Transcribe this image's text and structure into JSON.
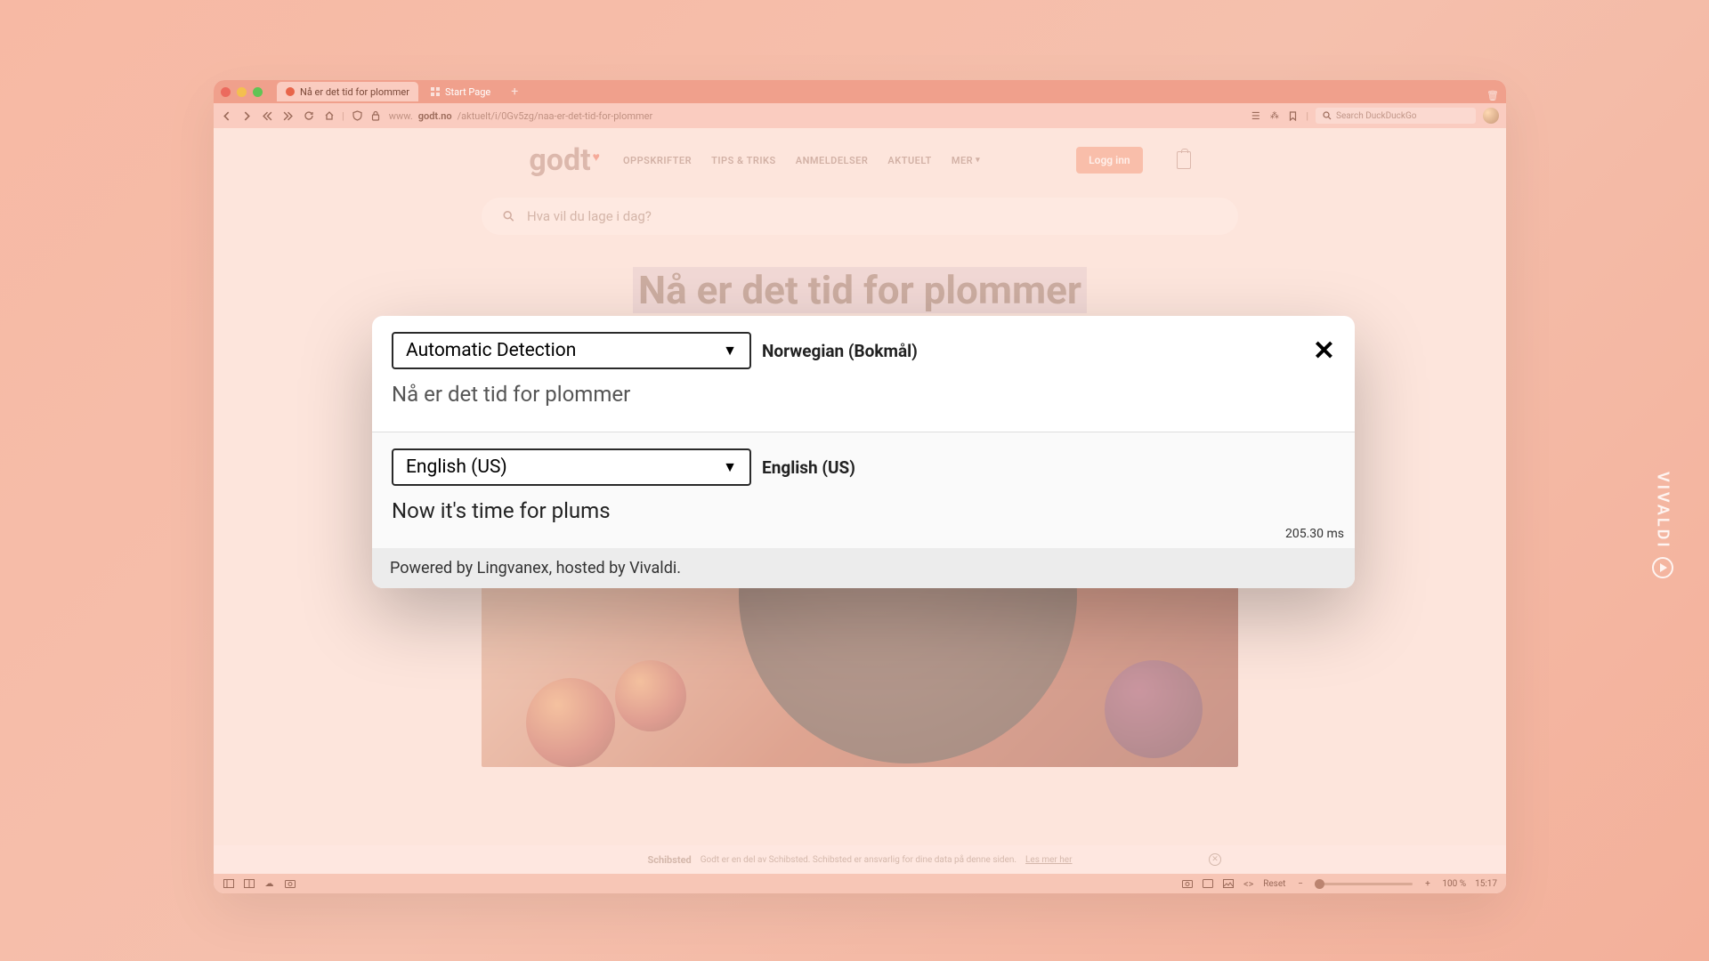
{
  "tabs": {
    "active": {
      "title": "Nå er det tid for plommer"
    },
    "second": {
      "title": "Start Page"
    }
  },
  "address": {
    "proto": "www.",
    "host": "godt.no",
    "path": "/aktuelt/i/0Gv5zg/naa-er-det-tid-for-plommer"
  },
  "search": {
    "placeholder": "Search DuckDuckGo"
  },
  "site": {
    "logo": "godt",
    "nav": {
      "oppskrifter": "OPPSKRIFTER",
      "tips": "TIPS & TRIKS",
      "anmeld": "ANMELDELSER",
      "aktuelt": "AKTUELT",
      "mer": "MER"
    },
    "login": "Logg inn",
    "searchbar_placeholder": "Hva vil du lage i dag?",
    "headline": "Nå er det tid for plommer",
    "schibsted_brand": "Schibsted",
    "schibsted_text": "Godt er en del av Schibsted. Schibsted er ansvarlig for dine data på denne siden.",
    "schibsted_link": "Les mer her"
  },
  "statusbar": {
    "reset": "Reset",
    "zoom": "100 %",
    "clock": "15:17"
  },
  "popup": {
    "source_select": "Automatic Detection",
    "source_detected": "Norwegian (Bokmål)",
    "source_text": "Nå er det tid for plommer",
    "target_select": "English (US)",
    "target_detected": "English (US)",
    "target_text": "Now it's time for plums",
    "timing": "205.30 ms",
    "footer": "Powered by Lingvanex, hosted by Vivaldi."
  },
  "watermark": "VIVALDI"
}
